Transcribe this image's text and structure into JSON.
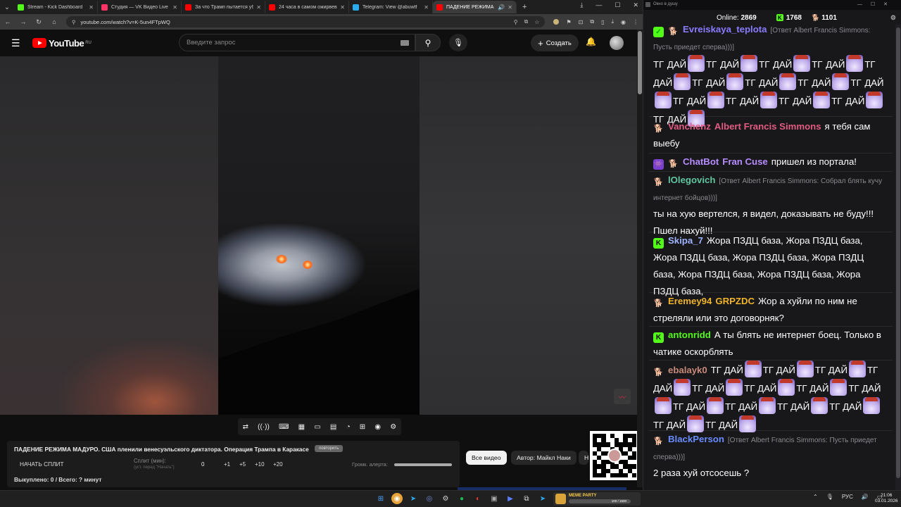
{
  "browser": {
    "tabs": [
      {
        "label": "Stream - Kick Dashboard",
        "color": "#53fc18"
      },
      {
        "label": "Студия — VK Видео Live",
        "color": "#ff3366"
      },
      {
        "label": "За что Трамп пытается убить",
        "color": "#ff0000"
      },
      {
        "label": "24 часа в самом ожирвевшем",
        "color": "#ff0000"
      },
      {
        "label": "Telegram: View @abuwtf",
        "color": "#2aabee"
      },
      {
        "label": "ПАДЕНИЕ РЕЖИМА МАДУ",
        "color": "#ff0000"
      }
    ],
    "url": "youtube.com/watch?v=K-5un4FTpWQ"
  },
  "youtube": {
    "brand": "YouTube",
    "region": "RU",
    "search_placeholder": "Введите запрос",
    "create_label": "Создать"
  },
  "video_tools": [
    "⇄",
    "((·))",
    "⌨",
    "▦",
    "▭",
    "▤",
    "◔",
    "⊞",
    "◉",
    "⚙"
  ],
  "panel": {
    "title": "ПАДЕНИЕ РЕЖИМА МАДУРО. США пленили венесуэльского диктатора. Операция Трампа в Каракасе",
    "badge": "повторить",
    "split_button": "НАЧАТЬ СПЛИТ",
    "split_label": "Сплит (мин):",
    "split_hint": "(уст. перед \"Начать\")",
    "split_value": "0",
    "increments": [
      "+1",
      "+5",
      "+10",
      "+20"
    ],
    "alert_label": "Громк. алерта:",
    "bought": "Выкуплено: 0 / Всего: ? минут"
  },
  "chips": {
    "all": "Все видео",
    "author": "Автор: Майкл Наки",
    "next": "Н"
  },
  "chat": {
    "window_title": "Окно в душу",
    "online_label": "Online:",
    "online_value": "2869",
    "kick_count": "1768",
    "emote_count": "1101",
    "messages": [
      {
        "icon": "check",
        "user": "Evreiskaya_teplota",
        "color": "#8a7bff",
        "reply": "[Ответ Albert Francis Simmons: Пусть приедет сперва)))]",
        "text": "ТГ ДАЙ ТГ ДАЙ ТГ ДАЙ ТГ ДАЙ ТГ ДАЙ ТГ ДАЙ ТГ ДАЙ ТГ ДАЙ ТГ ДАЙ ТГ ДАЙ ТГ ДАЙ ТГ ДАЙ ТГ ДАЙ ТГ ДАЙ"
      },
      {
        "icon": "dog",
        "user": "Vanchenz",
        "color": "#e35b82",
        "mention": "Albert Francis Simmons",
        "mention_color": "#e35b82",
        "text": "я тебя сам выебу"
      },
      {
        "icon": "bot",
        "user": "ChatBot",
        "color": "#b78cff",
        "mention": "Fran Cuse",
        "mention_color": "#b78cff",
        "text": "пришел из портала!"
      },
      {
        "icon": "dog",
        "user": "lOlegovich",
        "color": "#5fc6a0",
        "reply": "[Ответ Albert Francis Simmons: Собрал блять кучу интернет бойцов)))]",
        "text": "ты на хую вертелся, я видел, доказывать не буду!!! Пшел нахуй!!!"
      },
      {
        "icon": "kick",
        "user": "Skipa_7",
        "color": "#9fb3ff",
        "text": "Жора ПЗДЦ база, Жора ПЗДЦ база, Жора ПЗДЦ база, Жора ПЗДЦ база, Жора ПЗДЦ база, Жора ПЗДЦ база, Жора ПЗДЦ база, Жора ПЗДЦ база,"
      },
      {
        "icon": "dog",
        "user": "Eremey94",
        "color": "#f0b429",
        "mention": "GRPZDC",
        "mention_color": "#f0b429",
        "text": "Жор а хуйли по ним не стреляли или это договорняк?"
      },
      {
        "icon": "kick",
        "user": "antonridd",
        "color": "#53fc18",
        "text": "А ты блять не интернет боец. Только в чатике оскорблять"
      },
      {
        "icon": "dog",
        "user": "ebalayk0",
        "color": "#c98a7a",
        "text": "ТГ ДАЙ ТГ ДАЙ ТГ ДАЙ ТГ ДАЙ ТГ ДАЙ ТГ ДАЙ ТГ ДАЙ ТГ ДАЙ ТГ ДАЙ ТГ ДАЙ ТГ ДАЙ ТГ ДАЙ ТГ ДАЙ ТГ ДАЙ"
      },
      {
        "icon": "dog",
        "user": "BlackPerson",
        "color": "#6a8cff",
        "reply": "[Ответ Albert Francis Simmons: Пусть приедет сперва)))]",
        "text": "2 раза хуй отсосешь ?"
      }
    ]
  },
  "taskbar": {
    "meme_title": "MEME PARTY",
    "meme_progress": "100 / 1500",
    "lang": "РУС",
    "time": "21:06",
    "date": "03.01.2026"
  }
}
